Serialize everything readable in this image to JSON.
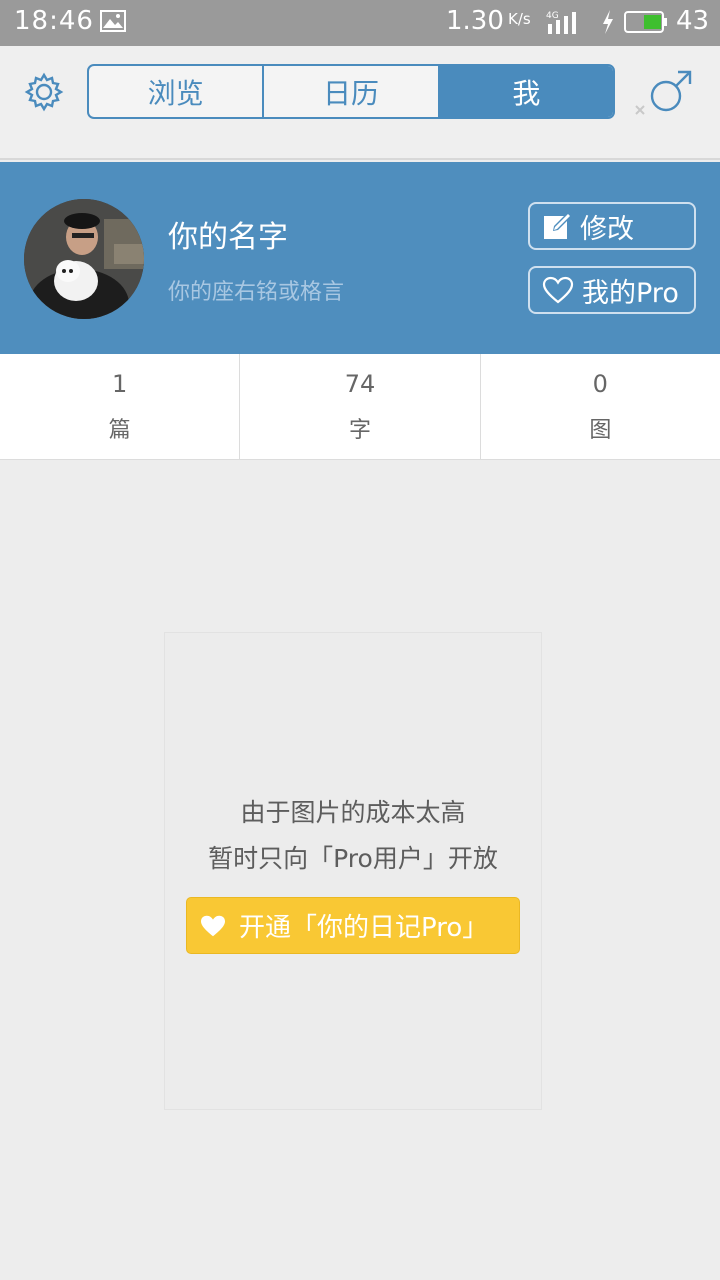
{
  "status_bar": {
    "time": "18:46",
    "speed": "1.30",
    "speed_unit": "K/s",
    "network": "4G",
    "battery": "43"
  },
  "nav": {
    "tabs": [
      {
        "label": "浏览",
        "active": false
      },
      {
        "label": "日历",
        "active": false
      },
      {
        "label": "我",
        "active": true
      }
    ]
  },
  "profile": {
    "name": "你的名字",
    "motto": "你的座右铭或格言",
    "edit_label": "修改",
    "pro_label": "我的Pro"
  },
  "stats": [
    {
      "value": "1",
      "unit": "篇"
    },
    {
      "value": "74",
      "unit": "字"
    },
    {
      "value": "0",
      "unit": "图"
    }
  ],
  "pro_card": {
    "line1": "由于图片的成本太高",
    "line2": "暂时只向「Pro用户」开放",
    "cta_label": "开通「你的日记Pro」"
  },
  "colors": {
    "accent": "#4a8bbd",
    "profile_bg": "#4f8ebe",
    "cta_yellow": "#f9c834",
    "battery_green": "#3fbf2f"
  }
}
